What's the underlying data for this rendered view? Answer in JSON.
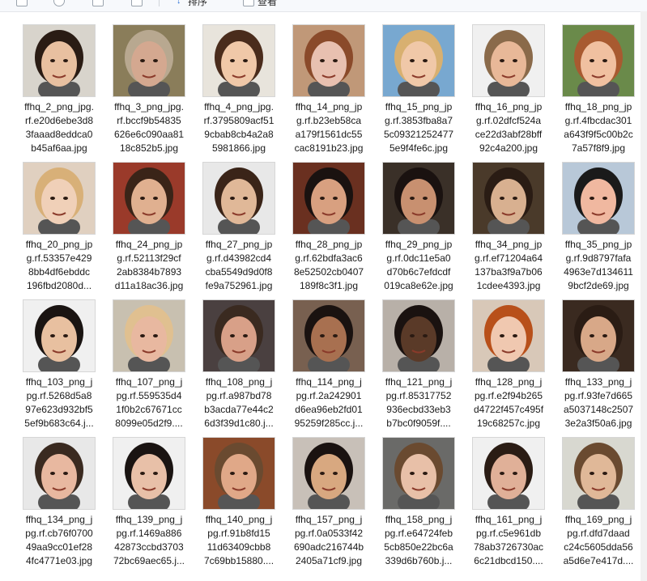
{
  "toolbar": {
    "items": [
      {
        "icon": "select-icon"
      },
      {
        "icon": "share-icon"
      },
      {
        "icon": "checkbox-icon"
      },
      {
        "icon": "delete-icon"
      }
    ],
    "sort_label": "排序",
    "view_label": "查看"
  },
  "files": [
    {
      "lines": [
        "ffhq_2_png_jpg.",
        "rf.e20d6ebe3d8",
        "3faaad8eddca0",
        "b45af6aa.jpg"
      ],
      "skin": "#e8c0a0",
      "hair": "#2a1c14",
      "bg": "#d8d4cc"
    },
    {
      "lines": [
        "ffhq_3_png_jpg.",
        "rf.bccf9b54835",
        "626e6c090aa81",
        "18c852b5.jpg"
      ],
      "skin": "#d4a890",
      "hair": "#b8a890",
      "bg": "#8a7d5a"
    },
    {
      "lines": [
        "ffhq_4_png_jpg.",
        "rf.3795809acf51",
        "9cbab8cb4a2a8",
        "5981866.jpg"
      ],
      "skin": "#f0c8a8",
      "hair": "#4a2c1c",
      "bg": "#e8e4dc"
    },
    {
      "lines": [
        "ffhq_14_png_jp",
        "g.rf.b23eb58ca",
        "a179f1561dc55",
        "cac8191b23.jpg"
      ],
      "skin": "#e8c0b0",
      "hair": "#8a4a2a",
      "bg": "#c09878"
    },
    {
      "lines": [
        "ffhq_15_png_jp",
        "g.rf.3853fba8a7",
        "5c09321252477",
        "5e9f4fe6c.jpg"
      ],
      "skin": "#f0c8a8",
      "hair": "#d8b070",
      "bg": "#78a8d0"
    },
    {
      "lines": [
        "ffhq_16_png_jp",
        "g.rf.02dfcf524a",
        "ce22d3abf28bff",
        "92c4a200.jpg"
      ],
      "skin": "#e8b898",
      "hair": "#8a6a4a",
      "bg": "#f0f0f0"
    },
    {
      "lines": [
        "ffhq_18_png_jp",
        "g.rf.4fbcdac301",
        "a643f9f5c00b2c",
        "7a57f8f9.jpg"
      ],
      "skin": "#f0c0a0",
      "hair": "#a85a30",
      "bg": "#6a8a4a"
    },
    {
      "lines": [
        "ffhq_20_png_jp",
        "g.rf.53357e429",
        "8bb4df6ebddc",
        "196fbd2080d..."
      ],
      "skin": "#f0d0b8",
      "hair": "#d8b078",
      "bg": "#e0d0c0"
    },
    {
      "lines": [
        "ffhq_24_png_jp",
        "g.rf.52113f29cf",
        "2ab8384b7893",
        "d11a18ac36.jpg"
      ],
      "skin": "#e0b090",
      "hair": "#3a2418",
      "bg": "#9a3a2a"
    },
    {
      "lines": [
        "ffhq_27_png_jp",
        "g.rf.d43982cd4",
        "cba5549d9d0f8",
        "fe9a752961.jpg"
      ],
      "skin": "#e0b898",
      "hair": "#3a2418",
      "bg": "#e8e8e8"
    },
    {
      "lines": [
        "ffhq_28_png_jp",
        "g.rf.62bdfa3ac6",
        "8e52502cb0407",
        "189f8c3f1.jpg"
      ],
      "skin": "#d8a080",
      "hair": "#1a1210",
      "bg": "#6a3020"
    },
    {
      "lines": [
        "ffhq_29_png_jp",
        "g.rf.0dc11e5a0",
        "d70b6c7efdcdf",
        "019ca8e62e.jpg"
      ],
      "skin": "#c89070",
      "hair": "#1a1210",
      "bg": "#3a3028"
    },
    {
      "lines": [
        "ffhq_34_png_jp",
        "g.rf.ef71204a64",
        "137ba3f9a7b06",
        "1cdee4393.jpg"
      ],
      "skin": "#d8b090",
      "hair": "#2a1c14",
      "bg": "#4a3a2a"
    },
    {
      "lines": [
        "ffhq_35_png_jp",
        "g.rf.9d8797fafa",
        "4963e7d134611",
        "9bcf2de69.jpg"
      ],
      "skin": "#f0b8a0",
      "hair": "#1a1a1a",
      "bg": "#b8c8d8"
    },
    {
      "lines": [
        "ffhq_103_png_j",
        "pg.rf.5268d5a8",
        "97e623d932bf5",
        "5ef9b683c64.j..."
      ],
      "skin": "#e8c0a0",
      "hair": "#1a1412",
      "bg": "#f0f0f0"
    },
    {
      "lines": [
        "ffhq_107_png_j",
        "pg.rf.559535d4",
        "1f0b2c67671cc",
        "8099e05d2f9...."
      ],
      "skin": "#e8b8a0",
      "hair": "#e0c090",
      "bg": "#c8c0b0"
    },
    {
      "lines": [
        "ffhq_108_png_j",
        "pg.rf.a987bd78",
        "b3acda77e44c2",
        "6d3f39d1c80.j..."
      ],
      "skin": "#d8a088",
      "hair": "#3a2a20",
      "bg": "#4a4040"
    },
    {
      "lines": [
        "ffhq_114_png_j",
        "pg.rf.2a242901",
        "d6ea96eb2fd01",
        "95259f285cc.j..."
      ],
      "skin": "#a87050",
      "hair": "#1a1210",
      "bg": "#786050"
    },
    {
      "lines": [
        "ffhq_121_png_j",
        "pg.rf.85317752",
        "936ecbd33eb3",
        "b7bc0f9059f...."
      ],
      "skin": "#5a3a28",
      "hair": "#1a1210",
      "bg": "#b8b0a8"
    },
    {
      "lines": [
        "ffhq_128_png_j",
        "pg.rf.e2f94b265",
        "d4722f457c495f",
        "19c68257c.jpg"
      ],
      "skin": "#f0c8b0",
      "hair": "#b8501a",
      "bg": "#d8c8b8"
    },
    {
      "lines": [
        "ffhq_133_png_j",
        "pg.rf.93fe7d665",
        "a5037148c2507",
        "3e2a3f50a6.jpg"
      ],
      "skin": "#d8a888",
      "hair": "#2a1c14",
      "bg": "#3a2a20"
    },
    {
      "lines": [
        "ffhq_134_png_j",
        "pg.rf.cb76f0700",
        "49aa9cc01ef28",
        "4fc4771e03.jpg"
      ],
      "skin": "#e8b8a0",
      "hair": "#3a2a20",
      "bg": "#e8e8e8"
    },
    {
      "lines": [
        "ffhq_139_png_j",
        "pg.rf.1469a886",
        "42873ccbd3703",
        "72bc69aec65.j..."
      ],
      "skin": "#e8c0a8",
      "hair": "#1a1412",
      "bg": "#f0f0f0"
    },
    {
      "lines": [
        "ffhq_140_png_j",
        "pg.rf.91b8fd15",
        "11d63409cbb8",
        "7c69bb15880...."
      ],
      "skin": "#e0a888",
      "hair": "#6a4a30",
      "bg": "#8a4a2a"
    },
    {
      "lines": [
        "ffhq_157_png_j",
        "pg.rf.0a0533f42",
        "690adc216744b",
        "2405a71cf9.jpg"
      ],
      "skin": "#d8a880",
      "hair": "#1a1210",
      "bg": "#c8c0b8"
    },
    {
      "lines": [
        "ffhq_158_png_j",
        "pg.rf.e64724feb",
        "5cb850e22bc6a",
        "339d6b760b.j..."
      ],
      "skin": "#e8c0a8",
      "hair": "#6a4a30",
      "bg": "#6a6a68"
    },
    {
      "lines": [
        "ffhq_161_png_j",
        "pg.rf.c5e961db",
        "78ab3726730ac",
        "6c21dbcd150...."
      ],
      "skin": "#e0b098",
      "hair": "#2a1c14",
      "bg": "#f0f0f0"
    },
    {
      "lines": [
        "ffhq_169_png_j",
        "pg.rf.dfd7daad",
        "c24c5605dda56",
        "a5d6e7e417d...."
      ],
      "skin": "#e0b898",
      "hair": "#6a4a30",
      "bg": "#d8d8d0"
    }
  ]
}
